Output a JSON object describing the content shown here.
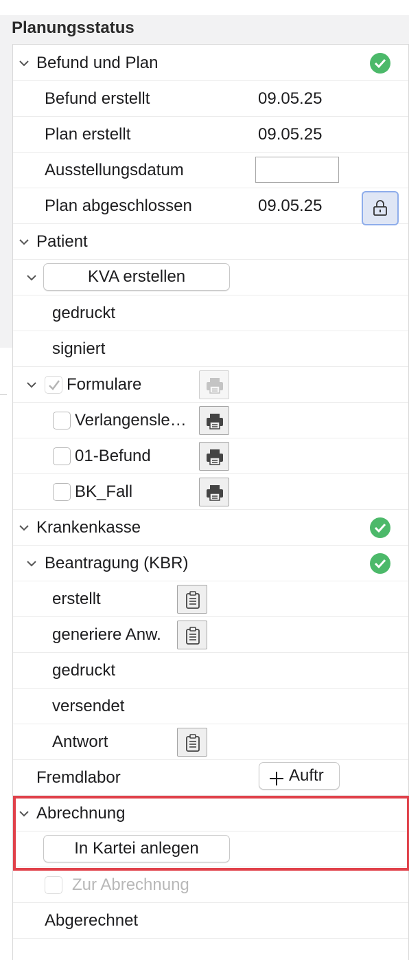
{
  "section_title": "Planungsstatus",
  "befund_und_plan": {
    "label": "Befund und Plan",
    "befund_erstellt": {
      "label": "Befund erstellt",
      "value": "09.05.25"
    },
    "plan_erstellt": {
      "label": "Plan erstellt",
      "value": "09.05.25"
    },
    "ausstellungsdatum": {
      "label": "Ausstellungsdatum",
      "value": ""
    },
    "plan_abgeschlossen": {
      "label": "Plan abgeschlossen",
      "value": "09.05.25"
    }
  },
  "patient": {
    "label": "Patient",
    "kva_button": "KVA erstellen",
    "gedruckt": "gedruckt",
    "signiert": "signiert",
    "formulare": {
      "label": "Formulare",
      "items": [
        {
          "label": "Verlangensle…"
        },
        {
          "label": "01-Befund"
        },
        {
          "label": "BK_Fall"
        }
      ]
    }
  },
  "krankenkasse": {
    "label": "Krankenkasse",
    "beantragung": {
      "label": "Beantragung (KBR)",
      "erstellt": "erstellt",
      "generiere": "generiere Anw.",
      "gedruckt": "gedruckt",
      "versendet": "versendet",
      "antwort": "Antwort"
    }
  },
  "fremdlabor": {
    "label": "Fremdlabor",
    "button": "Auftr"
  },
  "abrechnung": {
    "label": "Abrechnung",
    "button": "In Kartei anlegen",
    "zur_abrechnung": "Zur Abrechnung",
    "abgerechnet": "Abgerechnet"
  },
  "colors": {
    "status_ok": "#4cb96a",
    "highlight_border": "#e0414a",
    "lock_focus": "#8eadeb"
  }
}
